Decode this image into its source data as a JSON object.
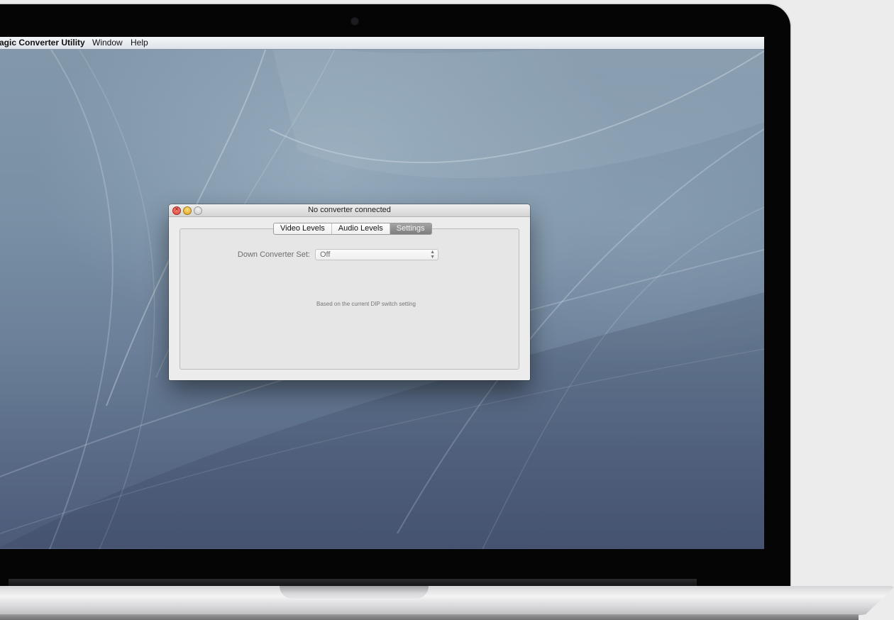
{
  "menubar": {
    "app_name": "agic Converter Utility",
    "window": "Window",
    "help": "Help"
  },
  "window": {
    "title": "No converter connected",
    "traffic_lights": [
      "close",
      "minimize",
      "zoom"
    ]
  },
  "tabs": [
    {
      "label": "Video Levels",
      "active": false
    },
    {
      "label": "Audio Levels",
      "active": false
    },
    {
      "label": "Settings",
      "active": true
    }
  ],
  "settings": {
    "down_converter_label": "Down Converter Set:",
    "down_converter_value": "Off",
    "help_text": "Based on the current DIP switch setting"
  },
  "icons": {
    "select_arrows": "up-down-chevron-icon",
    "close": "close-icon",
    "minimize": "minimize-icon",
    "zoom": "zoom-icon"
  },
  "colors": {
    "close_button": "#d63a2c",
    "minimize_button": "#d79b18",
    "zoom_button": "#c6c6c6",
    "active_tab": "#8c8c8c"
  }
}
